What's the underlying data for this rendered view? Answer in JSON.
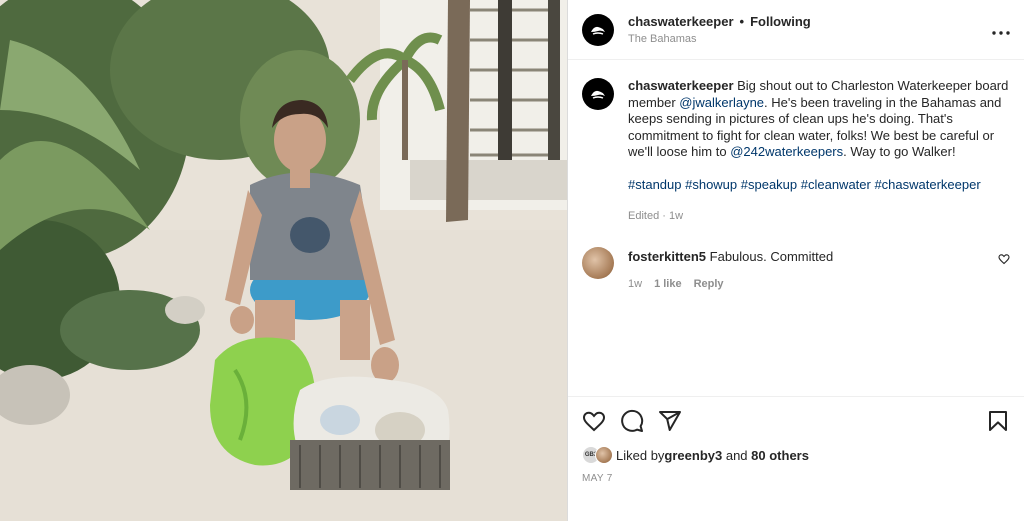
{
  "post": {
    "username": "chaswaterkeeper",
    "separator": "•",
    "follow_state": "Following",
    "location": "The Bahamas",
    "more_icon": "more-horizontal-icon"
  },
  "caption": {
    "username": "chaswaterkeeper",
    "part1": " Big shout out to Charleston Waterkeeper board member ",
    "mention1": "@jwalkerlayne",
    "part2": ". He's been traveling in the Bahamas and keeps sending in pictures of clean ups he's doing. That's commitment to fight for clean water, folks! We best be careful or we'll loose him to ",
    "mention2": "@242waterkeepers",
    "part3": ". Way to go Walker!",
    "hashtags": "#standup #showup #speakup #cleanwater #chaswaterkeeper",
    "edited": "Edited · 1w"
  },
  "comment": {
    "username": "fosterkitten5",
    "text": " Fabulous. Committed",
    "time": "1w",
    "likes": "1 like",
    "reply": "Reply"
  },
  "actions": {
    "liked_prefix": "Liked by ",
    "liked_user": "greenby3",
    "liked_and": " and ",
    "liked_others": "80 others",
    "mini_avatar_label": "GB3",
    "date": "MAY 7"
  },
  "colors": {
    "link": "#00376b",
    "muted": "#8e8e8e",
    "text": "#262626"
  }
}
